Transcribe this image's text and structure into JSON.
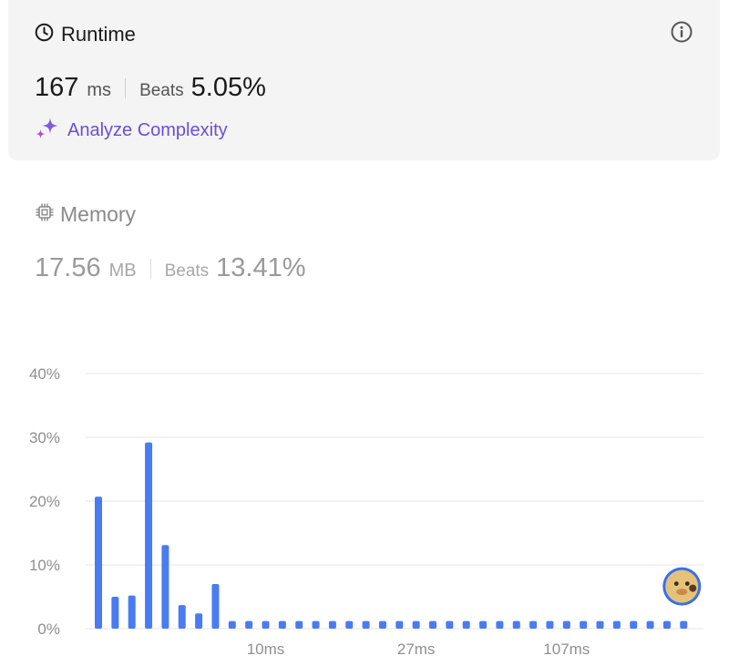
{
  "runtime": {
    "title": "Runtime",
    "value": "167",
    "unit": "ms",
    "beats_label": "Beats",
    "beats_value": "5.05%",
    "icon": "clock-icon",
    "info_icon": "info-icon",
    "analyze_label": "Analyze Complexity",
    "analyze_icon": "sparkle-icon",
    "analyze_color": "#6a4fd8"
  },
  "memory": {
    "title": "Memory",
    "value": "17.56",
    "unit": "MB",
    "beats_label": "Beats",
    "beats_value": "13.41%",
    "icon": "chip-icon"
  },
  "chart_data": {
    "type": "bar",
    "yticks": [
      "0%",
      "10%",
      "20%",
      "30%",
      "40%"
    ],
    "ylim": [
      0,
      40
    ],
    "xticks": [
      {
        "label": "10ms",
        "index": 10
      },
      {
        "label": "27ms",
        "index": 19
      },
      {
        "label": "107ms",
        "index": 28
      }
    ],
    "values": [
      20.7,
      5.0,
      5.2,
      29.2,
      13.1,
      3.7,
      2.4,
      7.0,
      1.2,
      1.2,
      1.2,
      1.2,
      1.2,
      1.2,
      1.2,
      1.2,
      1.2,
      1.2,
      1.2,
      1.2,
      1.2,
      1.2,
      1.2,
      1.2,
      1.2,
      1.2,
      1.2,
      1.2,
      1.2,
      1.2,
      1.2,
      1.2,
      1.2,
      1.2,
      1.2,
      1.2
    ],
    "bar_color": "#4a7bf0",
    "grid": true,
    "marker": {
      "index": 35,
      "label": "your submission",
      "icon": "avatar"
    }
  }
}
